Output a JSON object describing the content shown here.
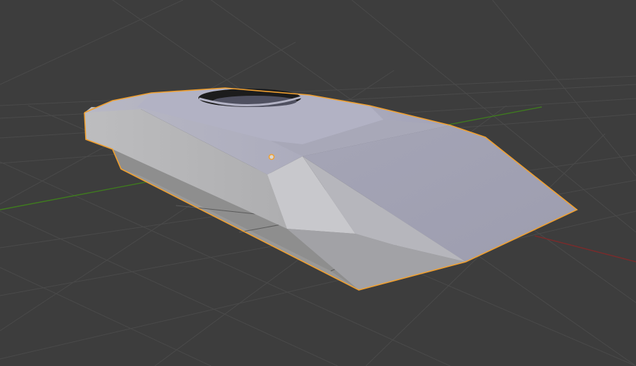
{
  "viewport": {
    "background_color": "#3d3d3d",
    "grid_color": "#4a4a4a",
    "x_axis_color": "#7a2b2b",
    "y_axis_color": "#3f7a1f"
  },
  "mesh": {
    "object_type": "tank-hull",
    "selected": true,
    "outline_color": "#f0a030",
    "origin_color": "#f0a030",
    "base_color": "#a9a9b4"
  }
}
